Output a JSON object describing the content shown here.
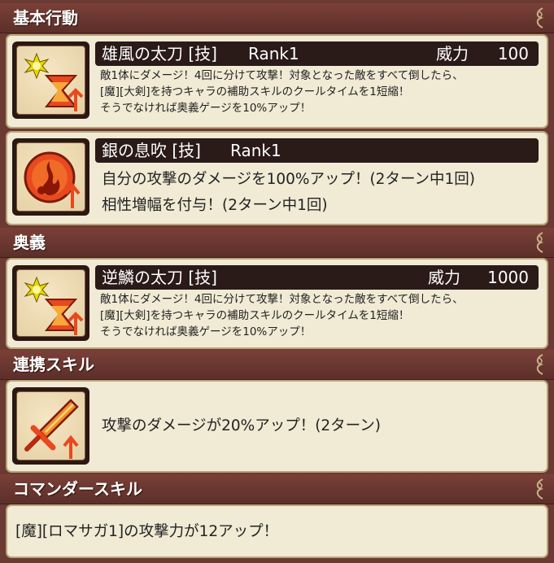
{
  "sections": {
    "basic": "基本行動",
    "ougi": "奥義",
    "renkei": "連携スキル",
    "commander": "コマンダースキル"
  },
  "skill1": {
    "name": "雄風の太刀 [技]",
    "rank": "Rank1",
    "power_label": "威力",
    "power_value": "100",
    "icon": "sword-burst-hourglass-icon",
    "desc": [
      "敵1体にダメージ！4回に分けて攻撃！対象となった敵をすべて倒したら、",
      "[魔][大剣]を持つキャラの補助スキルのクールタイムを1短縮！",
      "そうでなければ奥義ゲージを10%アップ！"
    ]
  },
  "skill2": {
    "name": "銀の息吹 [技]",
    "rank": "Rank1",
    "icon": "flame-buff-icon",
    "desc": [
      "自分の攻撃のダメージを100%アップ！(2ターン中1回)",
      "相性増幅を付与！(2ターン中1回)"
    ]
  },
  "ougi": {
    "name": "逆鱗の太刀 [技]",
    "power_label": "威力",
    "power_value": "1000",
    "icon": "sword-burst-hourglass-icon",
    "desc": [
      "敵1体にダメージ！4回に分けて攻撃！対象となった敵をすべて倒したら、",
      "[魔][大剣]を持つキャラの補助スキルのクールタイムを1短縮！",
      "そうでなければ奥義ゲージを10%アップ！"
    ]
  },
  "renkei": {
    "icon": "sword-up-icon",
    "desc": "攻撃のダメージが20%アップ！(2ターン)"
  },
  "commander": {
    "desc": "[魔][ロマサガ1]の攻撃力が12アップ！"
  }
}
